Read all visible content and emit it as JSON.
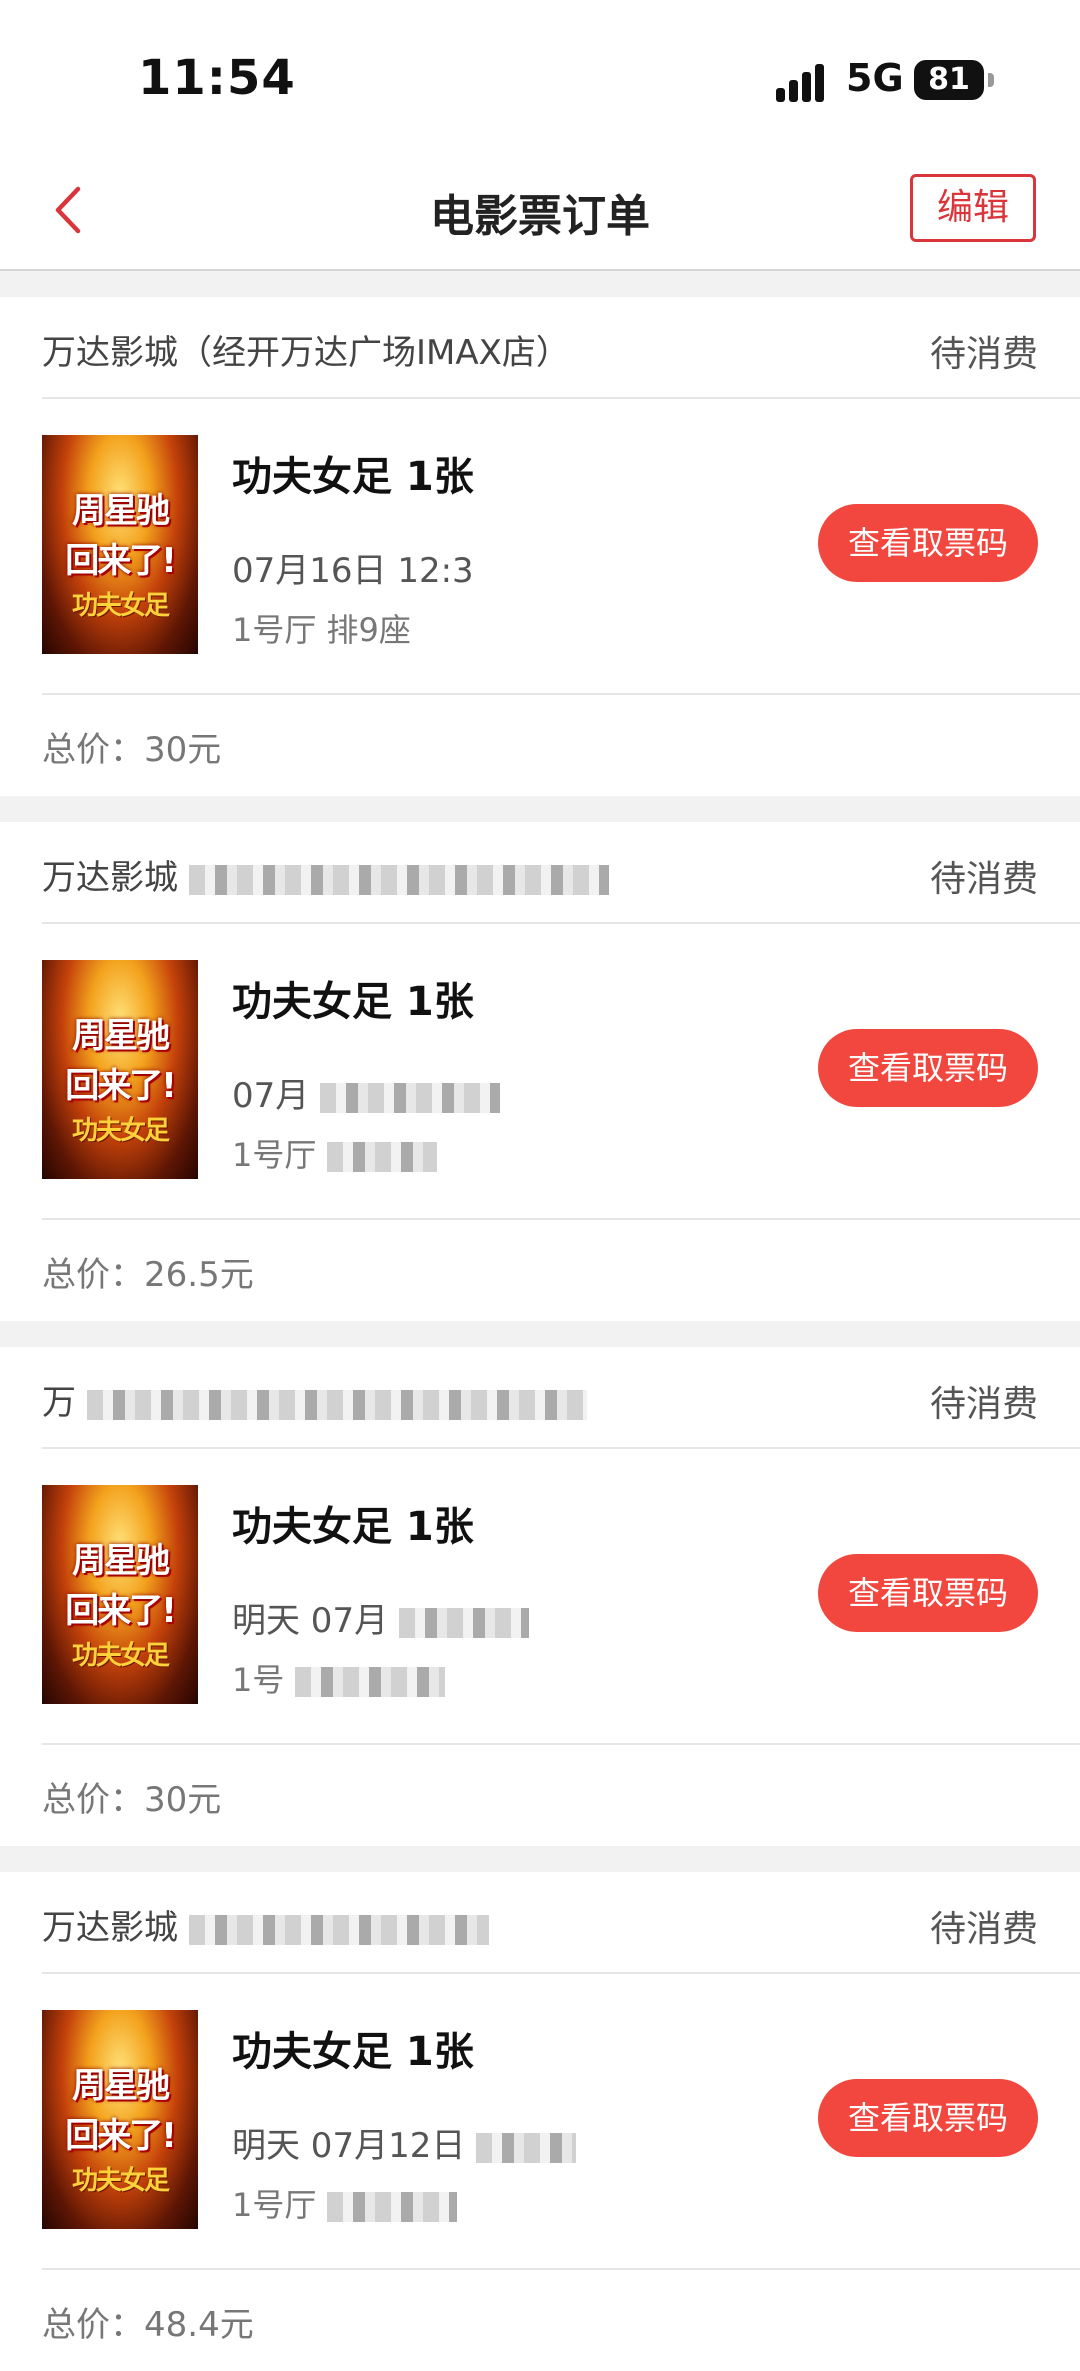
{
  "status_bar": {
    "time": "11:54",
    "network": "5G",
    "battery": "81"
  },
  "nav": {
    "title": "电影票订单",
    "edit_label": "编辑"
  },
  "orders": [
    {
      "cinema": "万达影城（经开万达广场IMAX店）",
      "status": "待消费",
      "poster_lines": [
        "周星驰",
        "回来了!",
        "功夫女足"
      ],
      "movie": "功夫女足 1张",
      "showtime": "07月16日 12:3",
      "seat": "1号厅 排9座",
      "button": "查看取票码",
      "total": "总价：30元"
    },
    {
      "cinema": "万达影城",
      "status": "待消费",
      "poster_lines": [
        "周星驰",
        "回来了!",
        "功夫女足"
      ],
      "movie": "功夫女足 1张",
      "showtime": "07月",
      "seat": "1号厅",
      "button": "查看取票码",
      "total": "总价：26.5元"
    },
    {
      "cinema": "万",
      "status": "待消费",
      "poster_lines": [
        "周星驰",
        "回来了!",
        "功夫女足"
      ],
      "movie": "功夫女足 1张",
      "showtime": "明天 07月",
      "seat": "1号",
      "button": "查看取票码",
      "total": "总价：30元"
    },
    {
      "cinema": "万达影城",
      "status": "待消费",
      "poster_lines": [
        "周星驰",
        "回来了!",
        "功夫女足"
      ],
      "movie": "功夫女足 1张",
      "showtime": "明天 07月12日",
      "seat": "1号厅",
      "button": "查看取票码",
      "total": "总价：48.4元"
    }
  ]
}
